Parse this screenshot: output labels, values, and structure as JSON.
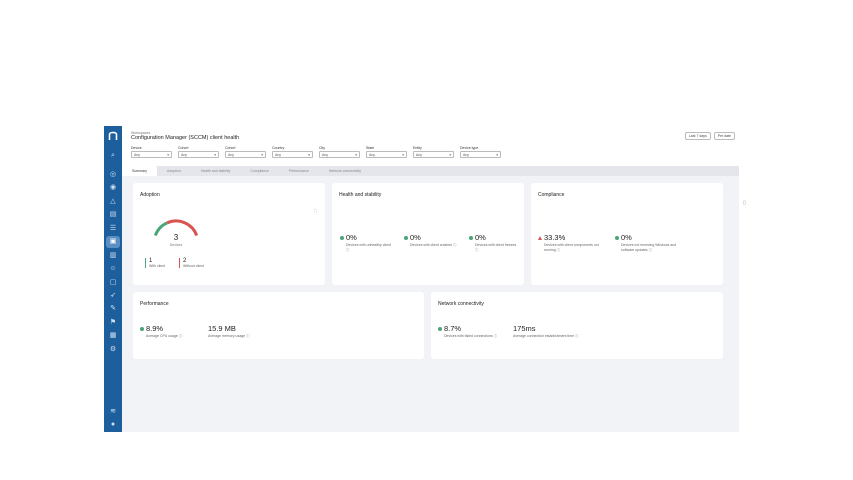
{
  "app": {
    "breadcrumb": "Workspaces",
    "title": "Configuration Manager (SCCM) client health",
    "header_buttons": [
      "Last 7 days",
      "Per date"
    ]
  },
  "filters": [
    {
      "label": "Device",
      "value": "Any"
    },
    {
      "label": "Cohort",
      "value": "Any"
    },
    {
      "label": "Cohort",
      "value": "Any"
    },
    {
      "label": "Country",
      "value": "Any"
    },
    {
      "label": "City",
      "value": "Any"
    },
    {
      "label": "State",
      "value": "Any"
    },
    {
      "label": "Entity",
      "value": "Any"
    },
    {
      "label": "Device type",
      "value": "Any"
    }
  ],
  "tabs": [
    "Summary",
    "Adoption",
    "Health and stability",
    "Compliance",
    "Performance",
    "Network connectivity"
  ],
  "adoption": {
    "title": "Adoption",
    "total": "3",
    "total_label": "Devices",
    "with_client": {
      "count": "1",
      "label": "With client"
    },
    "without_client": {
      "count": "2",
      "label": "Without client"
    },
    "with_client_fraction": 0.33,
    "colors": {
      "with": "#4aa57a",
      "without": "#d9534f"
    }
  },
  "health": {
    "title": "Health and stability",
    "metrics": [
      {
        "value": "0%",
        "desc": "Devices with unhealthy client"
      },
      {
        "value": "0%",
        "desc": "Devices with client crashes"
      },
      {
        "value": "0%",
        "desc": "Devices with client freezes"
      }
    ]
  },
  "compliance": {
    "title": "Compliance",
    "metrics": [
      {
        "value": "33.3%",
        "desc": "Devices with client components not running",
        "status": "warning"
      },
      {
        "value": "0%",
        "desc": "Devices not receiving Windows and software updates",
        "status": "ok"
      }
    ]
  },
  "performance": {
    "title": "Performance",
    "metrics": [
      {
        "value": "8.9%",
        "desc": "Average CPU usage"
      },
      {
        "value": "15.9 MB",
        "desc": "Average memory usage"
      }
    ]
  },
  "network": {
    "title": "Network connectivity",
    "metrics": [
      {
        "value": "8.7%",
        "desc": "Devices with failed connections"
      },
      {
        "value": "175ms",
        "desc": "Average connection establishment time"
      }
    ]
  },
  "sidebar": {
    "icons": [
      "search-icon",
      "dashboard-icon",
      "alerts-icon",
      "bell-icon",
      "chart-icon",
      "list-icon",
      "apps-icon",
      "sccm-icon",
      "report-icon",
      "users-icon",
      "device-icon",
      "rocket-icon",
      "tools-icon",
      "flag-icon",
      "library-icon",
      "settings-icon",
      "help-icon",
      "profile-icon"
    ]
  }
}
